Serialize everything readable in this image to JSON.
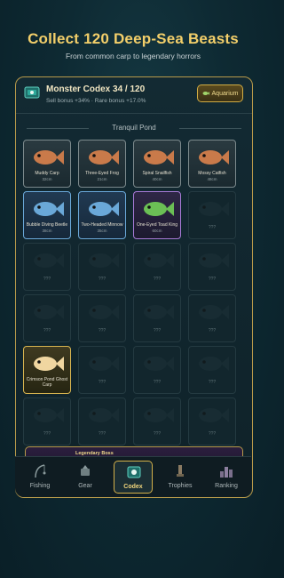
{
  "promo": {
    "headline": "Collect 120 Deep-Sea Beasts",
    "subline": "From common carp to legendary horrors"
  },
  "codex": {
    "title": "Monster Codex  34 / 120",
    "stats": "Sell bonus +34%  ·  Rare bonus +17.0%",
    "aquarium_label": "Aquarium",
    "section_label": "Tranquil Pond",
    "unknown_label": "???",
    "boss_label": "Legendary Boss",
    "fish": [
      {
        "name": "Muddy Carp",
        "size": "32cm",
        "rarity": "common",
        "icon": "carp-icon"
      },
      {
        "name": "Three-Eyed Frog",
        "size": "21cm",
        "rarity": "common",
        "icon": "frog-icon"
      },
      {
        "name": "Spiral Snailfish",
        "size": "40cm",
        "rarity": "common",
        "icon": "snail-icon"
      },
      {
        "name": "Mossy Catfish",
        "size": "48cm",
        "rarity": "common",
        "icon": "catfish-icon"
      },
      {
        "name": "Bubble Diving Beetle",
        "size": "38cm",
        "rarity": "rare",
        "icon": "beetle-icon"
      },
      {
        "name": "Two-Headed Minnow",
        "size": "35cm",
        "rarity": "rare",
        "icon": "minnow-icon"
      },
      {
        "name": "One-Eyed Toad King",
        "size": "60cm",
        "rarity": "epic",
        "icon": "toad-icon"
      },
      {
        "name": "Crimson Pond Ghost Carp",
        "size": "",
        "rarity": "gold",
        "icon": "ghost-carp-icon"
      }
    ]
  },
  "tabs": [
    {
      "label": "Fishing",
      "icon": "fishing-icon"
    },
    {
      "label": "Gear",
      "icon": "gear-icon"
    },
    {
      "label": "Codex",
      "icon": "codex-icon",
      "active": true
    },
    {
      "label": "Trophies",
      "icon": "trophy-icon"
    },
    {
      "label": "Ranking",
      "icon": "ranking-icon"
    }
  ],
  "colors": {
    "accent": "#f3cf6a",
    "panel_border": "#b89a4a",
    "rare": "#6aa8d8",
    "epic": "#a77ad6"
  }
}
